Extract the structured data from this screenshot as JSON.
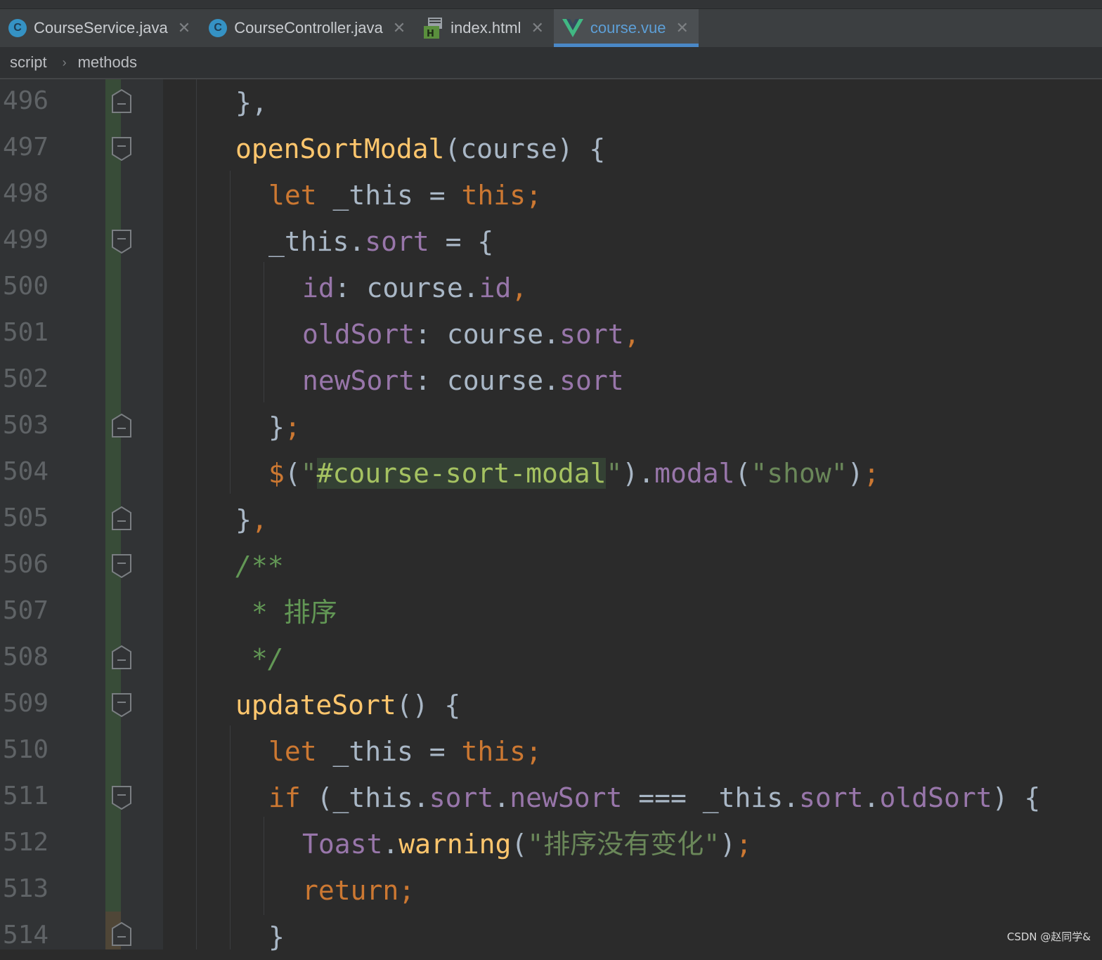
{
  "tabs": [
    {
      "label": "CourseService.java",
      "icon": "java-class-icon",
      "active": false
    },
    {
      "label": "CourseController.java",
      "icon": "java-class-icon",
      "active": false
    },
    {
      "label": "index.html",
      "icon": "html-file-icon",
      "active": false
    },
    {
      "label": "course.vue",
      "icon": "vue-file-icon",
      "active": true
    }
  ],
  "tab_close_glyph": "✕",
  "breadcrumb": {
    "items": [
      "script",
      "methods"
    ],
    "separator": "›"
  },
  "line_numbers": [
    "496",
    "497",
    "498",
    "499",
    "500",
    "501",
    "502",
    "503",
    "504",
    "505",
    "506",
    "507",
    "508",
    "509",
    "510",
    "511",
    "512",
    "513",
    "514"
  ],
  "code": {
    "l496": {
      "a": "},"
    },
    "l497": {
      "fn": "openSortModal",
      "rest": "(course) {"
    },
    "l498": {
      "kw1": "let",
      "mid": " _this = ",
      "kw2": "this;"
    },
    "l499": {
      "obj": "_this.",
      "prop": "sort",
      "rest": " = {"
    },
    "l500": {
      "key": "id",
      "mid": ": course.",
      "prop": "id",
      "comma": ","
    },
    "l501": {
      "key": "oldSort",
      "mid": ": course.",
      "prop": "sort",
      "comma": ","
    },
    "l502": {
      "key": "newSort",
      "mid": ": course.",
      "prop": "sort"
    },
    "l503": {
      "a": "}",
      "b": ";"
    },
    "l504": {
      "kw": "$",
      "p1": "(",
      "q1": "\"",
      "sel": "#course-sort-modal",
      "q2": "\"",
      "p2": ").",
      "method": "modal",
      "p3": "(",
      "arg": "\"show\"",
      "p4": ")",
      "semi": ";"
    },
    "l505": {
      "a": "}",
      "b": ","
    },
    "l506": {
      "cm": "/**"
    },
    "l507": {
      "star": " * ",
      "text": "排序"
    },
    "l508": {
      "cm": " */"
    },
    "l509": {
      "fn": "updateSort",
      "rest": "() {"
    },
    "l510": {
      "kw1": "let",
      "mid": " _this = ",
      "kw2": "this;"
    },
    "l511": {
      "kw": "if",
      "p1": " (_this.",
      "prop1": "sort",
      "dot1": ".",
      "prop2": "newSort",
      "op": " === _this.",
      "prop3": "sort",
      "dot2": ".",
      "prop4": "oldSort",
      "rest": ") {"
    },
    "l512": {
      "cls": "Toast",
      "dot": ".",
      "fn": "warning",
      "p1": "(",
      "str": "\"排序没有变化\"",
      "p2": ")",
      "semi": ";"
    },
    "l513": {
      "kw": "return;"
    },
    "l514": {
      "a": "}"
    }
  },
  "watermark": "CSDN @赵同学&",
  "colors": {
    "keyword": "#cc7832",
    "function": "#ffc66d",
    "property": "#9876aa",
    "string": "#6a8759",
    "comment": "#629755",
    "text": "#a9b7c6",
    "background": "#2b2b2b"
  }
}
